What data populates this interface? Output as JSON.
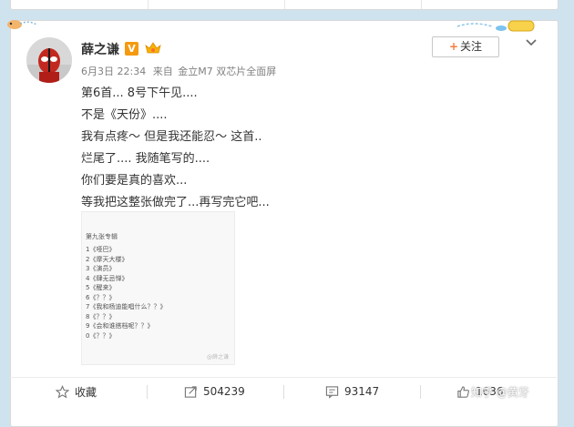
{
  "post": {
    "author": "薛之谦",
    "verified_badge": "V",
    "timestamp": "6月3日 22:34",
    "source_label": "来自",
    "device": "金立M7 双芯片全面屏",
    "follow_label": "关注",
    "content_lines": [
      "第6首... 8号下午见....",
      "不是《天份》....",
      "我有点疼～ 但是我还能忍～ 这首..",
      "烂尾了.... 我随笔写的....",
      "你们要是真的喜欢...",
      "等我把这整张做完了...再写完它吧..."
    ],
    "image": {
      "title": "第九张专辑",
      "tracks": [
        "1《哑巴》",
        "2《摩天大楼》",
        "3《演员》",
        "4《肆无忌惮》",
        "5《醒来》",
        "6《？？》",
        "7《我和杨迪能唱什么？？》",
        "8《？？》",
        "9《会和谁搭档呢？？》",
        "0《？？》"
      ],
      "watermark": "@薛之谦"
    }
  },
  "actions": {
    "favorite_label": "收藏",
    "repost_count": "504239",
    "comment_count": "93147",
    "like_count": "1636"
  },
  "overlay_watermark": "知乎 @黄牙",
  "colors": {
    "page_bg": "#cfe3ef",
    "verified_orange": "#f59a10",
    "follow_plus": "#f77c3d",
    "meta_gray": "#808080"
  }
}
